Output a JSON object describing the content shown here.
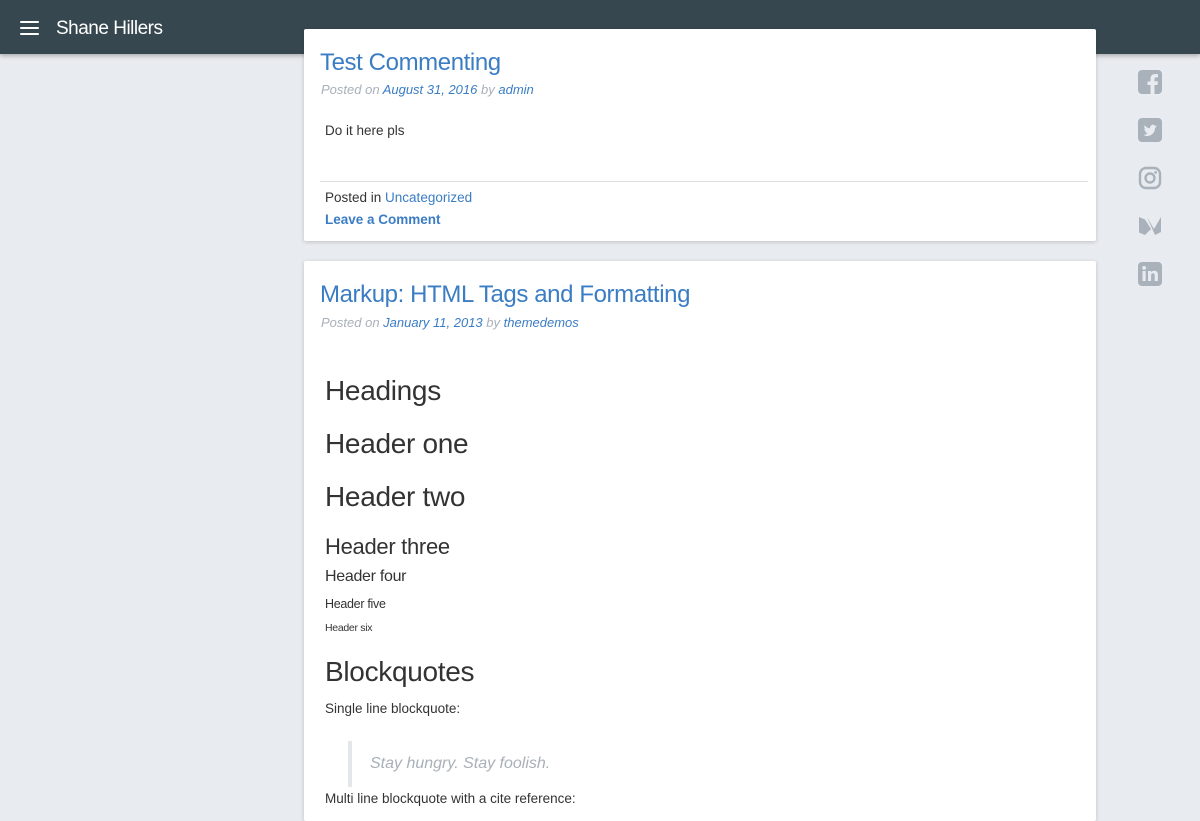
{
  "header": {
    "site_title": "Shane Hillers"
  },
  "posts": [
    {
      "title": "Test Commenting",
      "meta_prefix": "Posted on ",
      "date": "August 31, 2016",
      "meta_by": " by ",
      "author": "admin",
      "body": "Do it here pls",
      "posted_in_label": "Posted in ",
      "category": "Uncategorized",
      "comment_link": "Leave a Comment"
    },
    {
      "title": "Markup: HTML Tags and Formatting",
      "meta_prefix": "Posted on ",
      "date": "January 11, 2013",
      "meta_by": " by ",
      "author": "themedemos",
      "headings": {
        "section": "Headings",
        "h1": "Header one",
        "h2": "Header two",
        "h3": "Header three",
        "h4": "Header four",
        "h5": "Header five",
        "h6": "Header six"
      },
      "blockquotes": {
        "section": "Blockquotes",
        "single_label": "Single line blockquote:",
        "single_quote": "Stay hungry. Stay foolish.",
        "multi_label": "Multi line blockquote with a cite reference:"
      }
    }
  ],
  "social": [
    {
      "name": "facebook-icon"
    },
    {
      "name": "twitter-icon"
    },
    {
      "name": "instagram-icon"
    },
    {
      "name": "medium-icon"
    },
    {
      "name": "linkedin-icon"
    }
  ],
  "colors": {
    "topbar": "#37474f",
    "link": "#3b7dc4",
    "background": "#e8ebef",
    "muted": "#a8b0b8"
  }
}
